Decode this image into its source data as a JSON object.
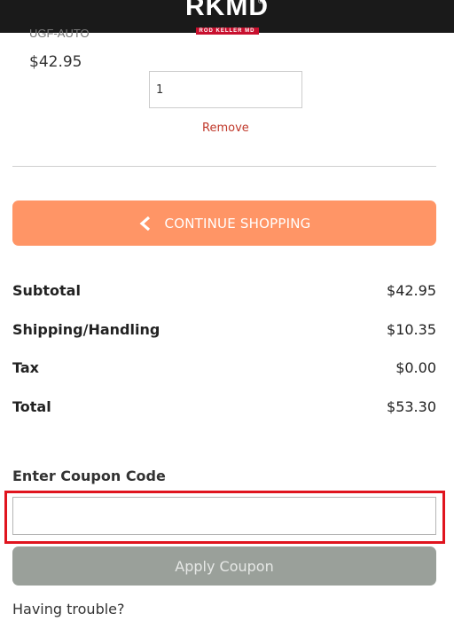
{
  "header": {
    "logo_text": "RKMD",
    "logo_subtext": "ROD KELLER MD",
    "logo_mark": "®"
  },
  "cart_item": {
    "sku": "UGF-AUTO",
    "price": "$42.95",
    "quantity": "1",
    "remove_label": "Remove"
  },
  "continue_shopping_label": "CONTINUE SHOPPING",
  "summary": {
    "rows": [
      {
        "label": "Subtotal",
        "value": "$42.95"
      },
      {
        "label": "Shipping/Handling",
        "value": "$10.35"
      },
      {
        "label": "Tax",
        "value": "$0.00"
      },
      {
        "label": "Total",
        "value": "$53.30"
      }
    ]
  },
  "coupon": {
    "heading": "Enter Coupon Code",
    "value": "",
    "apply_label": "Apply Coupon"
  },
  "help_text": "Having trouble?",
  "colors": {
    "header_bg": "#1a1a1a",
    "continue_button": "#ff9566",
    "remove_link": "#c0392b",
    "apply_button_disabled": "#9aa09a",
    "highlight_border": "#e0141e"
  },
  "icons": {
    "continue_shopping": "chevron-left-icon"
  }
}
